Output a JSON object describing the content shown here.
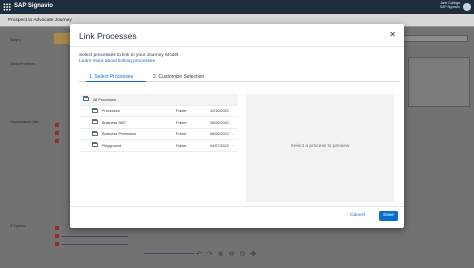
{
  "topbar": {
    "app_title": "SAP Signavio",
    "user_line1": "Jane Collings",
    "user_line2": "SAP Signavio"
  },
  "subbar": {
    "title": "Prospect to Advocate Journey"
  },
  "background": {
    "stage_label": "Stages",
    "rows": [
      "Linked Processes",
      "Organizational Units",
      "IT Systems"
    ]
  },
  "dialog": {
    "title": "Link Processes",
    "description": "Select processes to link to your Journey Model.",
    "learn_more": "Learn more about linking processes",
    "tabs": [
      {
        "label": "1. Select Processes",
        "active": true
      },
      {
        "label": "2. Customize Selection",
        "active": false
      }
    ],
    "list_header": "All Processes",
    "items": [
      {
        "name": "Processes",
        "type": "Folder",
        "date": "12/10/2021"
      },
      {
        "name": "Business 360°",
        "type": "Folder",
        "date": "26/05/2021"
      },
      {
        "name": "Business Processes",
        "type": "Folder",
        "date": "06/05/2021"
      },
      {
        "name": "Playground",
        "type": "Folder",
        "date": "04/07/2022"
      }
    ],
    "preview_placeholder": "Select a process to preview",
    "cancel_label": "Cancel",
    "save_label": "Save"
  },
  "colors": {
    "accent": "#0a6ed1",
    "shell": "#1d2d3e"
  }
}
